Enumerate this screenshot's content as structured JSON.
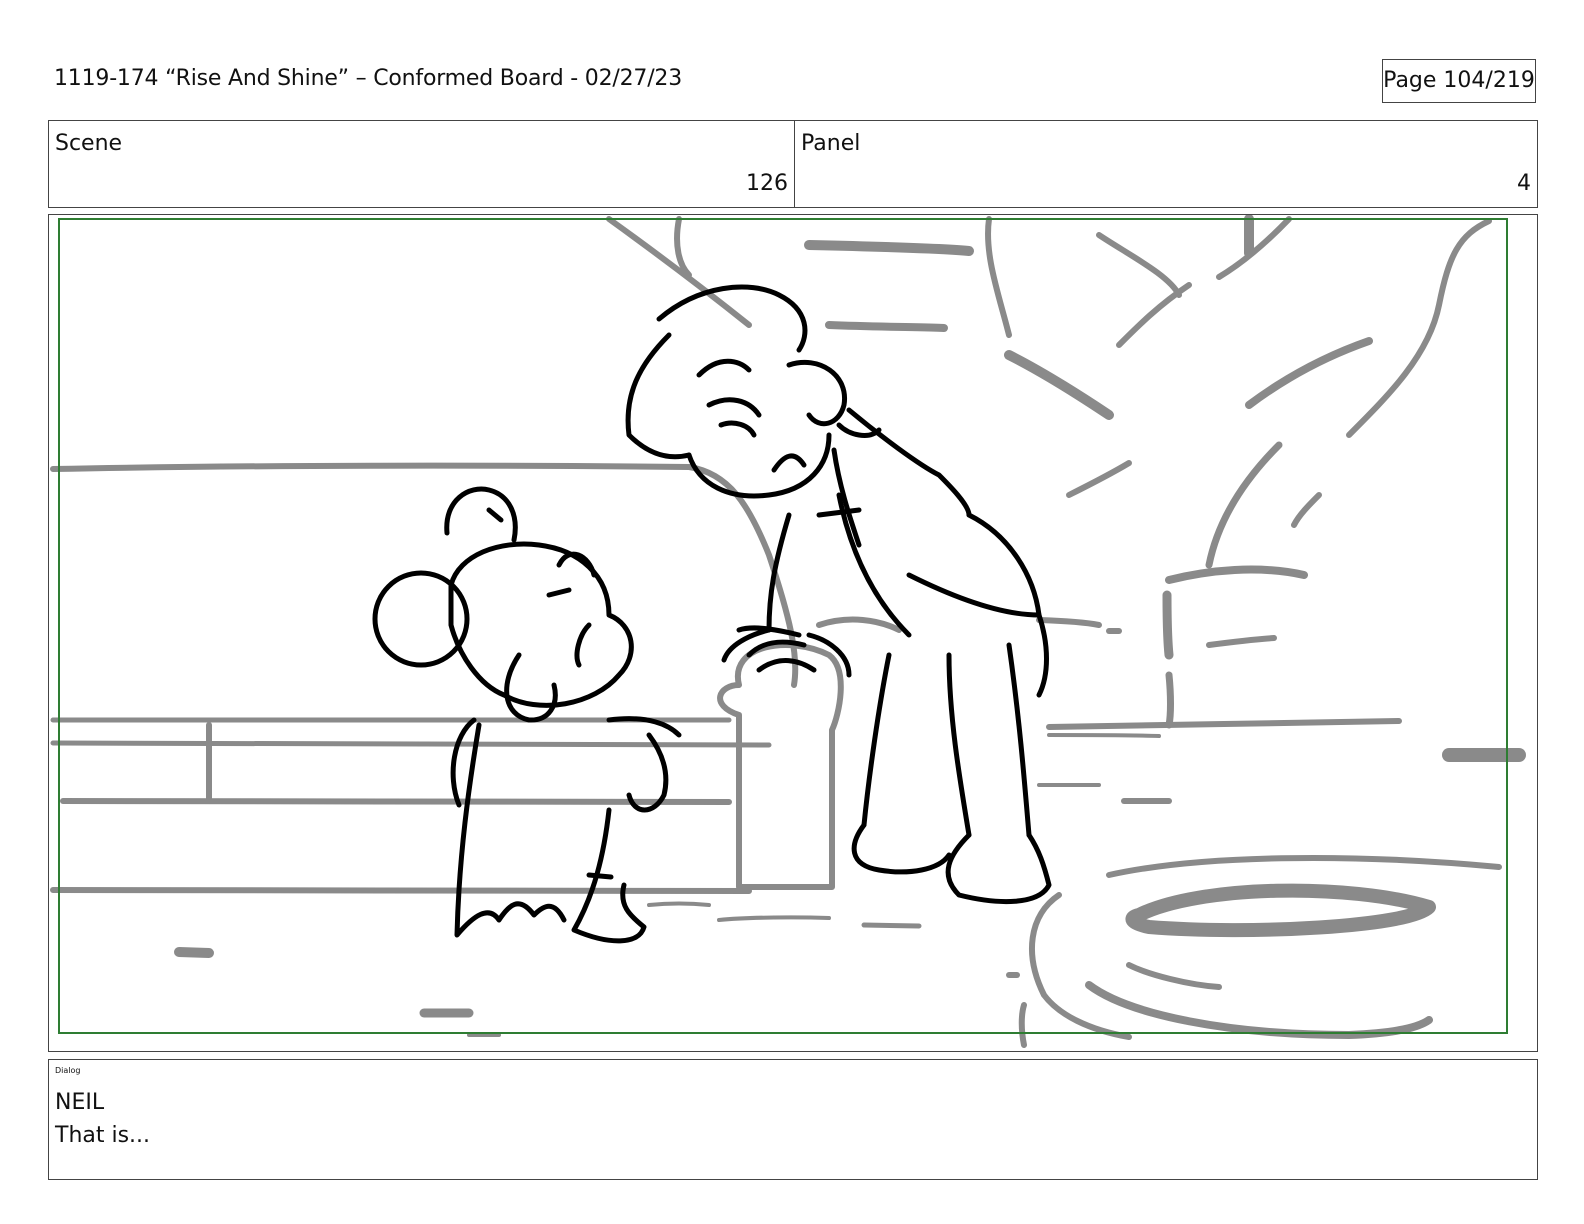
{
  "header": {
    "title": "1119-174 “Rise And Shine” – Conformed Board - 02/27/23",
    "page": "Page 104/219"
  },
  "info": {
    "scene_label": "Scene",
    "scene_value": "126",
    "panel_label": "Panel",
    "panel_value": "4"
  },
  "frame": {
    "safe_area_color": "#2e7d32",
    "background_line_color": "#8a8a8a",
    "character_line_color": "#000000"
  },
  "dialog": {
    "label": "Dialog",
    "speaker": "NEIL",
    "line": "That is..."
  }
}
